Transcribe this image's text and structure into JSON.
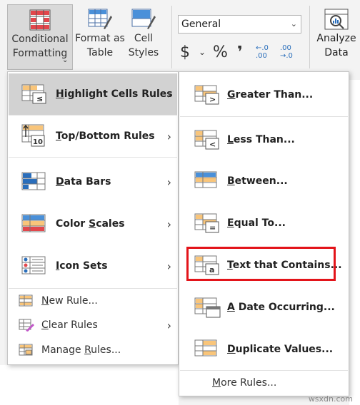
{
  "ribbon": {
    "conditional_formatting": "Conditional Formatting",
    "format_as_table": "Format as Table",
    "cell_styles": "Cell Styles",
    "number_format": "General",
    "currency": "$",
    "percent": "%",
    "comma": "❜",
    "inc_decimal": "←.0 .00",
    "dec_decimal": ".00 →.0",
    "analyze_data": "Analyze Data"
  },
  "menu": {
    "items": [
      {
        "pre": "",
        "u": "H",
        "post": "ighlight Cells Rules"
      },
      {
        "pre": "",
        "u": "T",
        "post": "op/Bottom Rules"
      },
      {
        "pre": "",
        "u": "D",
        "post": "ata Bars"
      },
      {
        "pre": "Color ",
        "u": "S",
        "post": "cales"
      },
      {
        "pre": "",
        "u": "I",
        "post": "con Sets"
      }
    ],
    "new_rule": {
      "pre": "",
      "u": "N",
      "post": "ew Rule..."
    },
    "clear_rules": {
      "pre": "",
      "u": "C",
      "post": "lear Rules"
    },
    "manage_rules": {
      "pre": "Manage ",
      "u": "R",
      "post": "ules..."
    }
  },
  "submenu": {
    "items": [
      {
        "pre": "",
        "u": "G",
        "post": "reater Than..."
      },
      {
        "pre": "",
        "u": "L",
        "post": "ess Than..."
      },
      {
        "pre": "",
        "u": "B",
        "post": "etween..."
      },
      {
        "pre": "",
        "u": "E",
        "post": "qual To..."
      },
      {
        "pre": "",
        "u": "T",
        "post": "ext that Contains..."
      },
      {
        "pre": "",
        "u": "A",
        "post": " Date Occurring..."
      },
      {
        "pre": "",
        "u": "D",
        "post": "uplicate Values..."
      }
    ],
    "more_rules": {
      "pre": "",
      "u": "M",
      "post": "ore Rules..."
    }
  },
  "watermark": "wsxdn.com",
  "colors": {
    "accent_red": "#e3141a",
    "highlight": "#d2d2d2",
    "cell_orange": "#f9c57a",
    "cell_blue": "#4a90d9"
  }
}
